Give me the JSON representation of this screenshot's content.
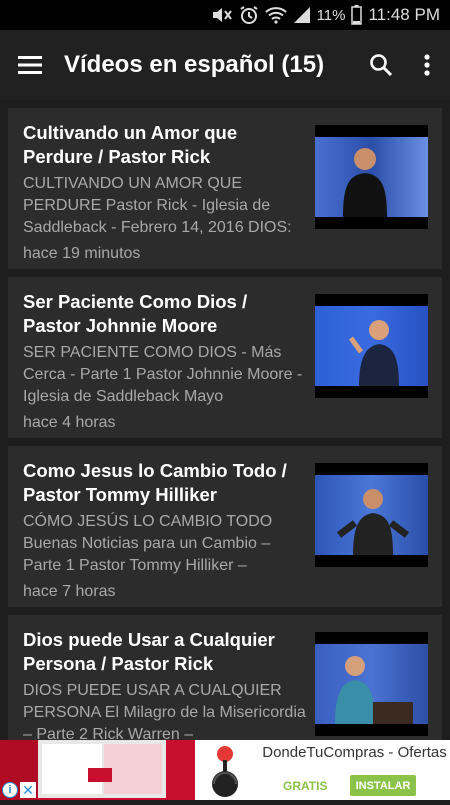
{
  "status": {
    "battery_pct": "11%",
    "time": "11:48 PM"
  },
  "app_bar": {
    "title": "Vídeos en español (15)"
  },
  "videos": [
    {
      "title": "Cultivando un Amor que Perdure / Pastor Rick",
      "desc": "CULTIVANDO UN AMOR QUE PERDURE Pastor Rick - Iglesia de Saddleback - Febrero 14, 2016 DIOS:",
      "time": "hace 19 minutos"
    },
    {
      "title": "Ser Paciente Como Dios / Pastor Johnnie Moore",
      "desc": "SER PACIENTE COMO DIOS - Más Cerca - Parte 1 Pastor Johnnie Moore - Iglesia de Saddleback Mayo",
      "time": "hace 4 horas"
    },
    {
      "title": "Como Jesus lo Cambio Todo / Pastor Tommy Hilliker",
      "desc": "CÓMO JESÚS LO CAMBIO TODO Buenas Noticias para un Cambio – Parte 1 Pastor Tommy Hilliker –",
      "time": "hace 7 horas"
    },
    {
      "title": "Dios puede Usar a Cualquier Persona / Pastor Rick",
      "desc": "DIOS PUEDE USAR A CUALQUIER PERSONA El Milagro de la Misericordia – Parte 2 Rick Warren –",
      "time": ""
    }
  ],
  "ad": {
    "app_name": "DondeTuCompras - Ofertas",
    "price": "GRATIS",
    "install_label": "INSTALAR"
  },
  "colors": {
    "app_bar": "#212121",
    "card": "#2c2c2c",
    "ad_accent": "#8bc34a",
    "ad_banner": "#c8102e"
  }
}
